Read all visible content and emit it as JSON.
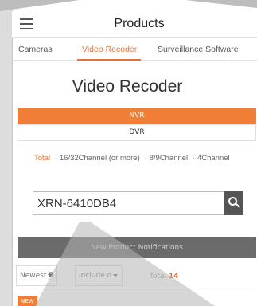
{
  "header": {
    "title": "Products"
  },
  "tabs": [
    {
      "label": "Cameras"
    },
    {
      "label": "Video Recoder"
    },
    {
      "label": "Surveillance Software"
    }
  ],
  "section": {
    "title": "Video Recoder"
  },
  "segments": {
    "nvr": "NVR",
    "dvr": "DVR"
  },
  "filters": {
    "total": "Total",
    "opt1": "16/32Channel (or more)",
    "opt2": "8/9Channel",
    "opt3": "4Channel"
  },
  "search": {
    "value": "XRN-6410DB4"
  },
  "notifications": {
    "label": "New Product Notifications"
  },
  "sort": {
    "newest": "Newest fi",
    "include": "Include d",
    "total_label": "Total",
    "total_count": "14"
  },
  "badge": {
    "new": "NEW"
  },
  "colors": {
    "accent": "#f07e36",
    "dark": "#555555"
  }
}
